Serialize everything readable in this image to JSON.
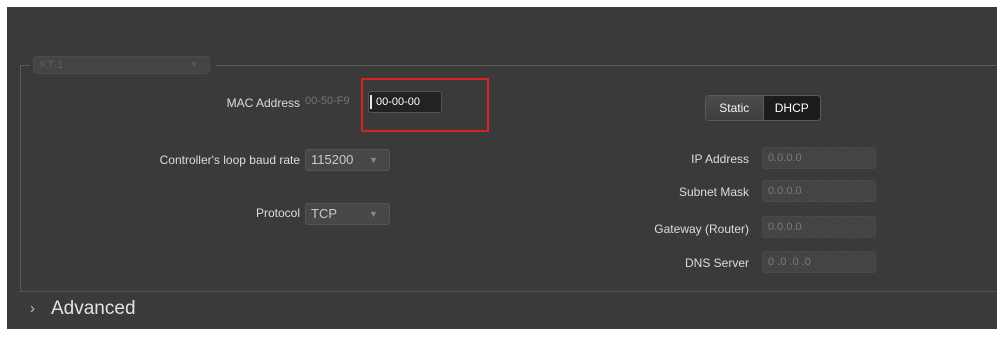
{
  "group": {
    "selected": "KT-1"
  },
  "mac": {
    "label": "MAC Address",
    "prefix": "00-50-F9",
    "value": "00-00-00"
  },
  "baud": {
    "label": "Controller's loop baud rate",
    "value": "115200"
  },
  "protocol": {
    "label": "Protocol",
    "value": "TCP"
  },
  "ip_mode": {
    "static_label": "Static",
    "dhcp_label": "DHCP",
    "selected": "DHCP"
  },
  "network": {
    "ip_label": "IP Address",
    "ip_value": "0.0.0.0",
    "subnet_label": "Subnet Mask",
    "subnet_value": "0.0.0.0",
    "gateway_label": "Gateway (Router)",
    "gateway_value": "0.0.0.0",
    "dns_label": "DNS Server",
    "dns_value": "0 .0 .0 .0"
  },
  "advanced": {
    "label": "Advanced"
  },
  "colors": {
    "panel": "#3a3a3a",
    "highlight": "#d8222a"
  },
  "icons": {
    "dropdown": "chevron-down-icon",
    "expand": "chevron-right-icon"
  }
}
